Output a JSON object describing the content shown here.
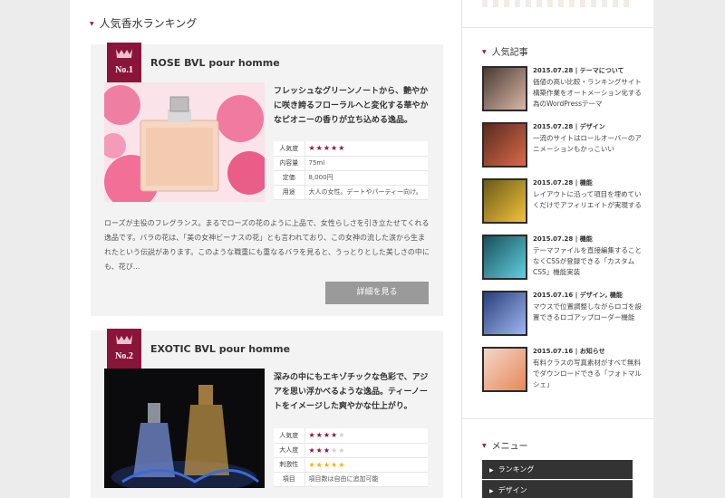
{
  "main": {
    "section_title": "人気香水ランキング",
    "cards": [
      {
        "rank": "No.1",
        "title": "ROSE BVL pour homme",
        "lead": "フレッシュなグリーンノートから、艶やかに咲き誇るフローラルへと変化する華やかなピオニーの香りが立ち込める逸品。",
        "specs": [
          {
            "key": "人気度",
            "value": "★★★★★"
          },
          {
            "key": "内容量",
            "value": "75ml"
          },
          {
            "key": "定価",
            "value": "8,000円"
          },
          {
            "key": "用途",
            "value": "大人の女性。デートやパーティー向け。"
          }
        ],
        "description": "ローズが主役のフレグランス。まるでローズの花のように上品で、女性らしさを引き立たせてくれる逸品です。バラの花は、「美の女神ビーナスの花」とも言われており、この女神の流した涙から生まれたという伝説があります。このような職重にも重なるバラを見ると、うっとりとした美しさの中にも、花び...",
        "button": "詳細を見る"
      },
      {
        "rank": "No.2",
        "title": "EXOTIC BVL pour homme",
        "lead": "深みの中にもエキゾチックな色彩で、アジアを思い浮かべるような逸品。ティーノートをイメージした爽やかな仕上がり。",
        "specs": [
          {
            "key": "人気度",
            "value": "★★★★★",
            "filled": 4
          },
          {
            "key": "大人度",
            "value": "★★★★★",
            "filled": 3
          },
          {
            "key": "刺激性",
            "value": "★★★★★",
            "filled": 5
          },
          {
            "key": "項目",
            "value": "項目数は自由に追加可能"
          }
        ]
      }
    ]
  },
  "side": {
    "popular_title": "人気記事",
    "popular": [
      {
        "date": "2015.07.28",
        "category": "テーマについて",
        "text": "価値の高い比較・ランキングサイト構築作業をオートメーション化する為のWordPressテーマ",
        "icon": "portrait-photo-icon"
      },
      {
        "date": "2015.07.28",
        "category": "デザイン",
        "text": "一流のサイトはロールオーバーのアニメーションもかっこいい",
        "icon": "perfume-bottles-photo-icon"
      },
      {
        "date": "2015.07.28",
        "category": "機能",
        "text": "レイアウトに沿って項目を埋めていくだけでアフィリエイトが実現する",
        "icon": "yellow-perfume-photo-icon"
      },
      {
        "date": "2015.07.28",
        "category": "機能",
        "text": "テーマファイルを直接編集することなくCSSが登録できる「カスタムCSS」機能実装",
        "icon": "blue-bottles-photo-icon"
      },
      {
        "date": "2015.07.16",
        "category": "デザイン, 機能",
        "text": "マウスで位置調整しながらロゴを設置できるロゴアップローダー機能",
        "icon": "blue-flower-photo-icon"
      },
      {
        "date": "2015.07.16",
        "category": "お知らせ",
        "text": "有料クラスの写真素材がすべて無料でダウンロードできる「フォトマルシェ」",
        "icon": "orange-lily-photo-icon"
      }
    ],
    "menu_title": "メニュー",
    "menu": [
      "ランキング",
      "デザイン"
    ]
  },
  "colors": {
    "accent": "#9b1b3c",
    "star": "#8a1538",
    "star_gold": "#f5b400",
    "button": "#9a9a9a"
  }
}
